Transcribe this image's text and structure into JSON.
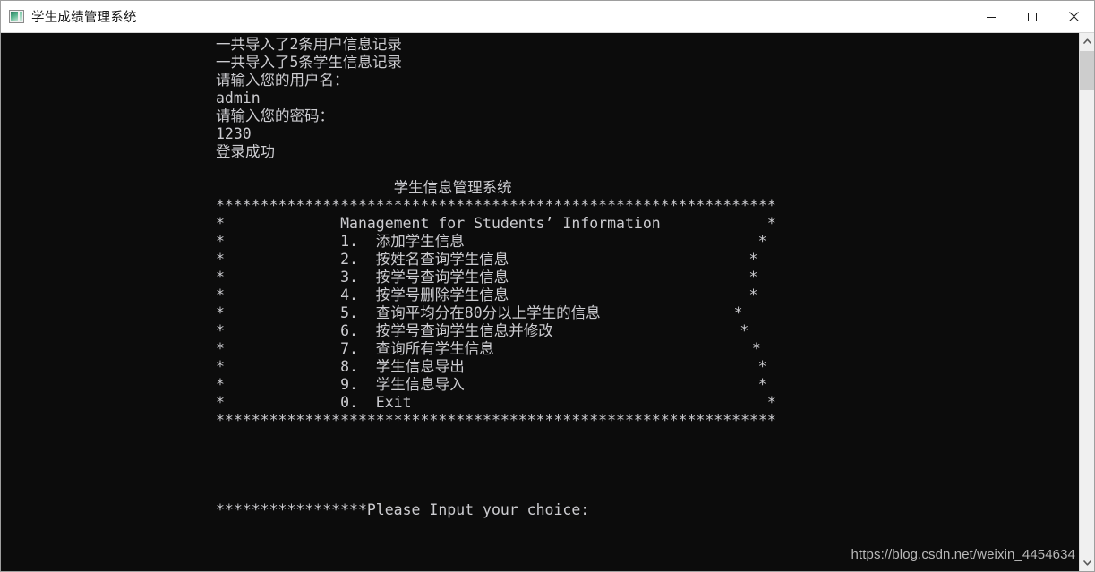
{
  "window": {
    "title": "学生成绩管理系统",
    "icon": "console-app-icon",
    "controls": {
      "minimize": "minimize-button",
      "maximize": "maximize-button",
      "close": "close-button"
    }
  },
  "console": {
    "background_color": "#0c0c0c",
    "text_color": "#ccccd0",
    "lines": [
      "一共导入了2条用户信息记录",
      "一共导入了5条学生信息记录",
      "请输入您的用户名：",
      "admin",
      "请输入您的密码：",
      "1230",
      "登录成功",
      "",
      "                    学生信息管理系统",
      "***************************************************************",
      "*             Management for Students’ Information            *",
      "*             1.  添加学生信息                                 *",
      "*             2.  按姓名查询学生信息                           *",
      "*             3.  按学号查询学生信息                           *",
      "*             4.  按学号删除学生信息                           *",
      "*             5.  查询平均分在80分以上学生的信息               *",
      "*             6.  按学号查询学生信息并修改                     *",
      "*             7.  查询所有学生信息                             *",
      "*             8.  学生信息导出                                 *",
      "*             9.  学生信息导入                                 *",
      "*             0.  Exit                                        *",
      "***************************************************************",
      "",
      "",
      "",
      "",
      "*****************Please Input your choice:"
    ],
    "import_user_records": "2",
    "import_student_records": "5",
    "username_prompt": "请输入您的用户名：",
    "username_value": "admin",
    "password_prompt": "请输入您的密码：",
    "password_value": "1230",
    "login_status": "登录成功",
    "menu_title": "学生信息管理系统",
    "menu_subtitle": "Management for Students’ Information",
    "border_char": "*",
    "menu_items": [
      {
        "key": "1.",
        "label": "添加学生信息"
      },
      {
        "key": "2.",
        "label": "按姓名查询学生信息"
      },
      {
        "key": "3.",
        "label": "按学号查询学生信息"
      },
      {
        "key": "4.",
        "label": "按学号删除学生信息"
      },
      {
        "key": "5.",
        "label": "查询平均分在80分以上学生的信息"
      },
      {
        "key": "6.",
        "label": "按学号查询学生信息并修改"
      },
      {
        "key": "7.",
        "label": "查询所有学生信息"
      },
      {
        "key": "8.",
        "label": "学生信息导出"
      },
      {
        "key": "9.",
        "label": "学生信息导入"
      },
      {
        "key": "0.",
        "label": "Exit"
      }
    ],
    "input_prompt": "*****************Please Input your choice:"
  },
  "scrollbar": {
    "up_arrow": "scroll-up-arrow",
    "down_arrow": "scroll-down-arrow"
  },
  "watermark": {
    "text": "https://blog.csdn.net/weixin_4454634"
  }
}
